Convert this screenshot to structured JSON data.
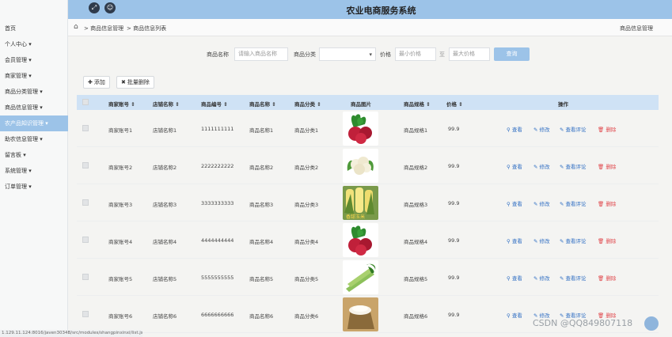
{
  "header": {
    "title": "农业电商服务系统",
    "left_icons": [
      "expand-icon",
      "user-icon"
    ]
  },
  "sidebar": {
    "items": [
      {
        "label": "首页",
        "active": false
      },
      {
        "label": "个人中心 ▾",
        "active": false
      },
      {
        "label": "会员管理 ▾",
        "active": false
      },
      {
        "label": "商家管理 ▾",
        "active": false
      },
      {
        "label": "商品分类管理 ▾",
        "active": false
      },
      {
        "label": "商品信息管理 ▾",
        "active": false
      },
      {
        "label": "农产品知识管理 ▾",
        "active": true
      },
      {
        "label": "助农信息管理 ▾",
        "active": false
      },
      {
        "label": "留言板 ▾",
        "active": false
      },
      {
        "label": "系统管理 ▾",
        "active": false
      },
      {
        "label": "订单管理 ▾",
        "active": false
      }
    ]
  },
  "breadcrumb": {
    "items": [
      "> 商品信息管理",
      "> 商品信息列表"
    ],
    "right": "商品信息管理"
  },
  "search": {
    "name_label": "商品名称",
    "name_placeholder": "请输入商品名称",
    "category_label": "商品分类",
    "category_value": "",
    "price_label": "价格",
    "min_placeholder": "最小价格",
    "separator": "至",
    "max_placeholder": "最大价格",
    "query_label": "查询"
  },
  "actions": {
    "add_label": "添加",
    "batch_delete_label": "批量删除"
  },
  "table": {
    "headers": [
      "商家账号 ⇕",
      "店铺名称 ⇕",
      "商品编号 ⇕",
      "商品名称 ⇕",
      "商品分类 ⇕",
      "商品图片",
      "商品规格 ⇕",
      "价格 ⇕",
      "操作"
    ],
    "ops": {
      "view": "查看",
      "edit": "修改",
      "comment": "查看评论",
      "delete": "删除"
    },
    "rows": [
      {
        "account": "商家账号1",
        "shop": "店铺名称1",
        "code": "1111111111",
        "name": "商品名称1",
        "category": "商品分类1",
        "image": "radish",
        "spec": "商品规格1",
        "price": "99.9"
      },
      {
        "account": "商家账号2",
        "shop": "店铺名称2",
        "code": "2222222222",
        "name": "商品名称2",
        "category": "商品分类2",
        "image": "cauliflower",
        "spec": "商品规格2",
        "price": "99.9"
      },
      {
        "account": "商家账号3",
        "shop": "店铺名称3",
        "code": "3333333333",
        "name": "商品名称3",
        "category": "商品分类3",
        "image": "corn",
        "image_caption": "香甜玉米",
        "spec": "商品规格3",
        "price": "99.9"
      },
      {
        "account": "商家账号4",
        "shop": "店铺名称4",
        "code": "4444444444",
        "name": "商品名称4",
        "category": "商品分类4",
        "image": "radish",
        "spec": "商品规格4",
        "price": "99.9"
      },
      {
        "account": "商家账号5",
        "shop": "店铺名称5",
        "code": "5555555555",
        "name": "商品名称5",
        "category": "商品分类5",
        "image": "celery",
        "spec": "商品规格5",
        "price": "99.9"
      },
      {
        "account": "商家账号6",
        "shop": "店铺名称6",
        "code": "6666666666",
        "name": "商品名称6",
        "category": "商品分类6",
        "image": "rice",
        "spec": "商品规格6",
        "price": "99.9"
      }
    ]
  },
  "status_url": "1.129.11.124:8016/javen3034B/src/modules/shangpinxinxi/list.jsp#",
  "watermark": "CSDN @QQ849807118",
  "colors": {
    "accent": "#9cc3e8",
    "link": "#2f6ec3",
    "danger": "#e0474c",
    "header_bg": "#cfe2f5"
  }
}
